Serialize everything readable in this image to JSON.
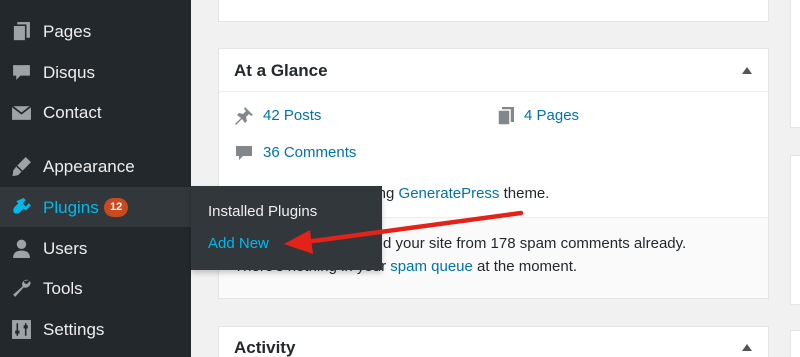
{
  "sidebar": {
    "items": [
      {
        "label": "Pages",
        "icon": "pages-icon"
      },
      {
        "label": "Disqus",
        "icon": "comment-bubble-icon"
      },
      {
        "label": "Contact",
        "icon": "envelope-icon"
      },
      {
        "label": "Appearance",
        "icon": "paintbrush-icon"
      },
      {
        "label": "Plugins",
        "icon": "plugin-plug-icon",
        "badge": "12"
      },
      {
        "label": "Users",
        "icon": "user-icon"
      },
      {
        "label": "Tools",
        "icon": "wrench-icon"
      },
      {
        "label": "Settings",
        "icon": "settings-sliders-icon"
      }
    ]
  },
  "flyout": {
    "installed": "Installed Plugins",
    "add_new": "Add New"
  },
  "glance": {
    "title": "At a Glance",
    "posts": "42 Posts",
    "pages": "4 Pages",
    "comments": "36 Comments",
    "theme_prefix": "ning ",
    "theme_name": "GeneratePress",
    "theme_suffix": " theme.",
    "akismet_line1": "d your site from 178 spam comments already.",
    "akismet_line2_prefix": "There's nothing in your ",
    "akismet_link": "spam queue",
    "akismet_line2_suffix": " at the moment."
  },
  "activity": {
    "title": "Activity"
  },
  "colors": {
    "sidebar_bg": "#23282d",
    "active_item_bg": "#32373c",
    "link_blue": "#0073aa",
    "active_blue": "#00b9eb",
    "badge_orange": "#ca4a1f",
    "arrow_red": "#e32219"
  }
}
